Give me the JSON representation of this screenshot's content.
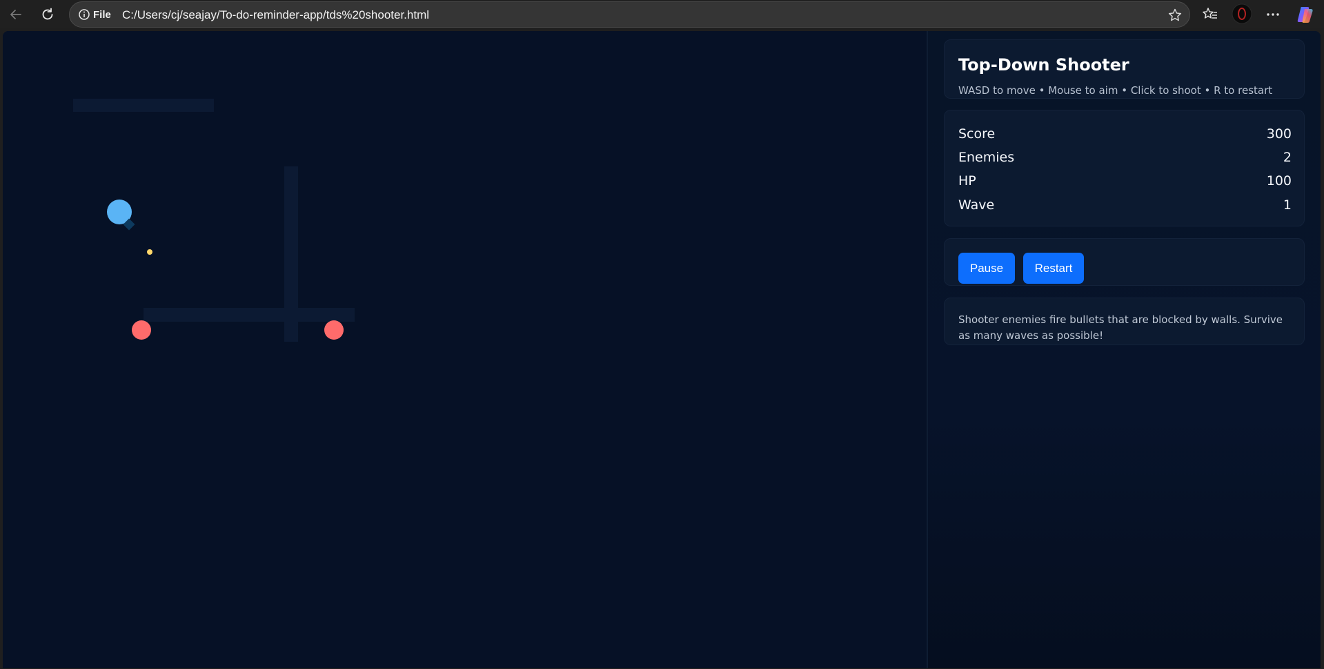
{
  "browser": {
    "file_label": "File",
    "url": "C:/Users/cj/seajay/To-do-reminder-app/tds%20shooter.html"
  },
  "panel": {
    "title": "Top-Down Shooter",
    "subtitle": "WASD to move • Mouse to aim • Click to shoot • R to restart",
    "stats": {
      "score_label": "Score",
      "score_value": "300",
      "enemies_label": "Enemies",
      "enemies_value": "2",
      "hp_label": "HP",
      "hp_value": "100",
      "wave_label": "Wave",
      "wave_value": "1"
    },
    "pause_label": "Pause",
    "restart_label": "Restart",
    "info": "Shooter enemies fire bullets that are blocked by walls. Survive as many waves as possible!"
  },
  "colors": {
    "player": "#5ab4f5",
    "enemy": "#ff6b6b",
    "bullet": "#ffd86b",
    "wall": "#0c1a33",
    "button": "#0d6efd"
  }
}
